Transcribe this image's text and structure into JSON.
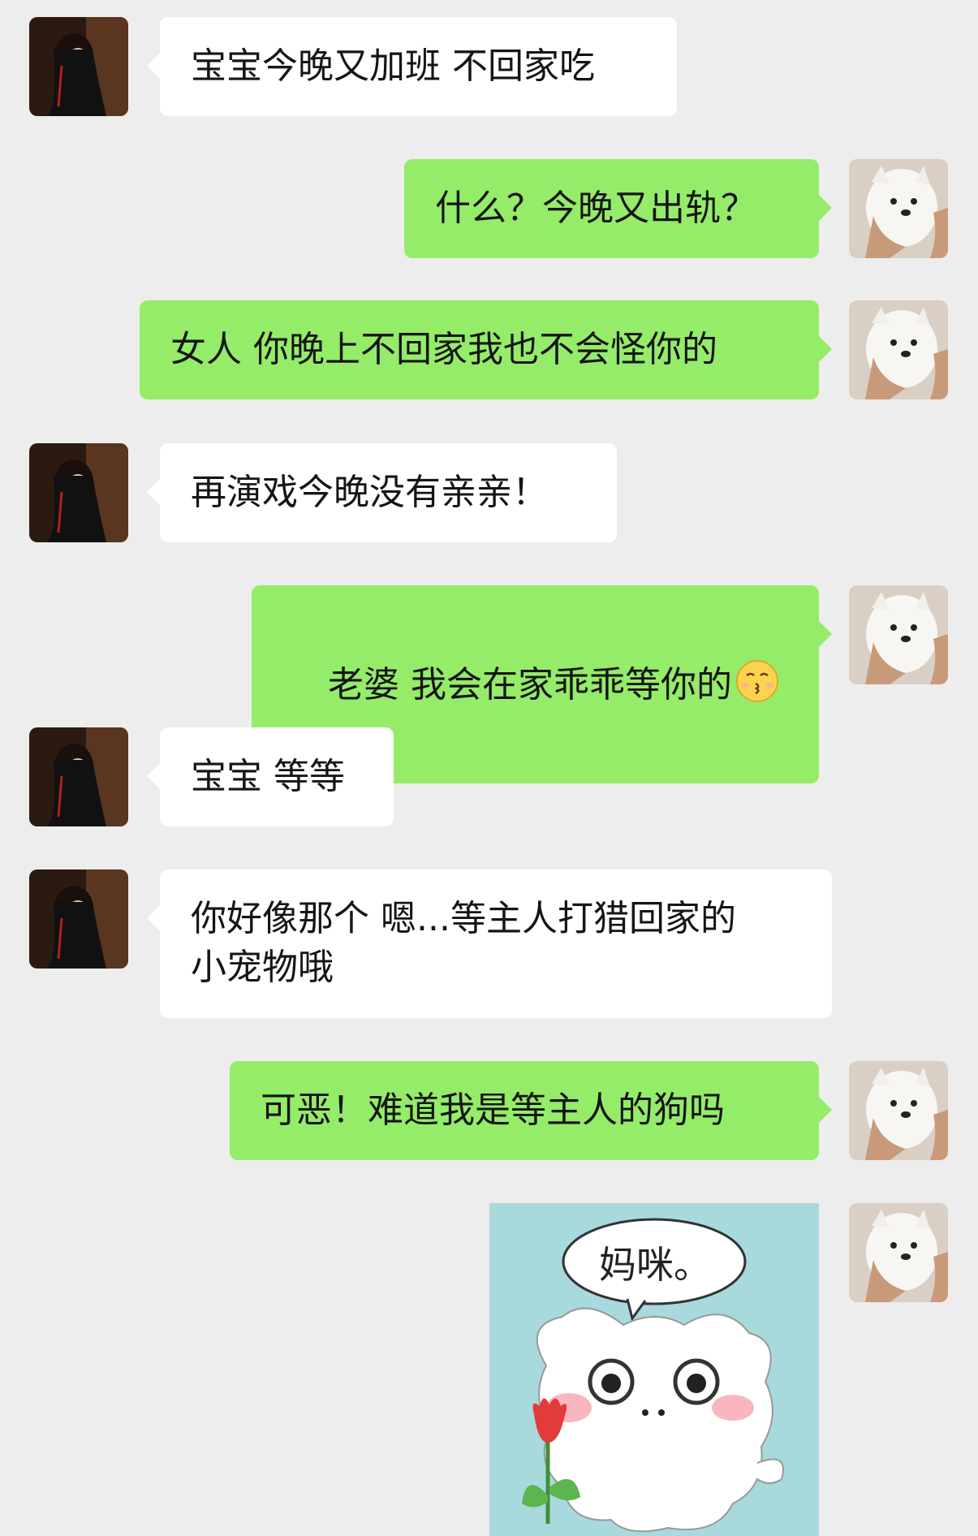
{
  "messages": [
    {
      "side": "left",
      "text": "宝宝今晚又加班 不回家吃"
    },
    {
      "side": "right",
      "text": "什么？今晚又出轨？"
    },
    {
      "side": "right",
      "text": "女人 你晚上不回家我也不会怪你的"
    },
    {
      "side": "left",
      "text": "再演戏今晚没有亲亲！"
    },
    {
      "side": "right",
      "text": "老婆 我会在家乖乖等你的",
      "emoji": "kissing-face-icon"
    },
    {
      "side": "left",
      "text": "宝宝 等等"
    },
    {
      "side": "left",
      "text": "你好像那个 嗯...等主人打猎回家的\n小宠物哦"
    },
    {
      "side": "right",
      "text": "可恶！难道我是等主人的狗吗"
    }
  ],
  "sticker": {
    "text": "妈咪。",
    "icon": "white-puppy-with-flower-sticker"
  },
  "avatars": {
    "left": "woman-avatar",
    "right": "samoyed-dog-avatar"
  },
  "colors": {
    "background": "#ededed",
    "sent_bubble": "#95ec69",
    "received_bubble": "#ffffff",
    "sticker_bg": "#a8d9dd"
  }
}
